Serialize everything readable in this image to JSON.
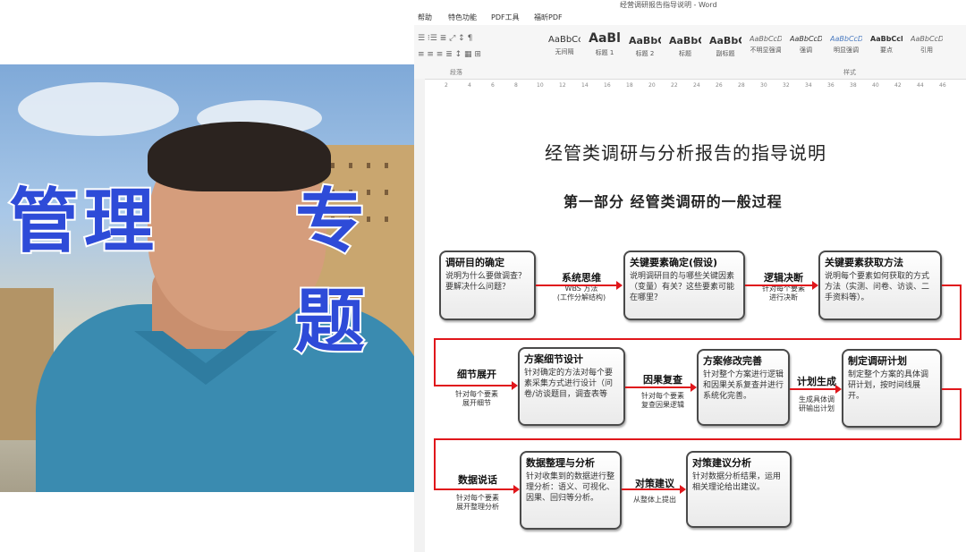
{
  "word": {
    "window_title": "经营调研报告指导说明 - Word",
    "menu": [
      "帮助",
      "特色功能",
      "PDF工具",
      "福昕PDF"
    ],
    "styles": [
      {
        "sample": "AaBbCcDd",
        "name": "无间隔"
      },
      {
        "sample": "AaBl",
        "name": "标题 1"
      },
      {
        "sample": "AaBbC",
        "name": "标题 2"
      },
      {
        "sample": "AaBbC",
        "name": "标题"
      },
      {
        "sample": "AaBbC",
        "name": "副标题"
      },
      {
        "sample": "AaBbCcD",
        "name": "不明显强调"
      },
      {
        "sample": "AaBbCcD",
        "name": "强调"
      },
      {
        "sample": "AaBbCcD",
        "name": "明显强调"
      },
      {
        "sample": "AaBbCcD",
        "name": "要点"
      },
      {
        "sample": "AaBbCcD",
        "name": "引用"
      }
    ],
    "group_paragraph": "段落",
    "group_styles": "样式",
    "ruler": [
      "2",
      "4",
      "6",
      "8",
      "10",
      "12",
      "14",
      "16",
      "18",
      "20",
      "22",
      "24",
      "26",
      "28",
      "30",
      "32",
      "34",
      "36",
      "38",
      "40",
      "42",
      "44",
      "46"
    ]
  },
  "webcam": {
    "banner_left": "管理",
    "banner_right": "专题"
  },
  "document": {
    "title": "经管类调研与分析报告的指导说明",
    "subtitle": "第一部分   经管类调研的一般过程"
  },
  "flow": {
    "boxes": [
      {
        "title": "调研目的确定",
        "desc": "说明为什么要做调查？要解决什么问题？"
      },
      {
        "title": "关键要素确定(假设)",
        "desc": "说明调研目的与哪些关键因素（变量）有关？这些要素可能在哪里？"
      },
      {
        "title": "关键要素获取方法",
        "desc": "说明每个要素如何获取的方式方法（实测、问卷、访谈、二手资料等）。"
      },
      {
        "title": "方案细节设计",
        "desc": "针对确定的方法对每个要素采集方式进行设计（问卷/访谈题目，调查表等"
      },
      {
        "title": "方案修改完善",
        "desc": "针对整个方案进行逻辑和因果关系复查并进行系统化完善。"
      },
      {
        "title": "制定调研计划",
        "desc": "制定整个方案的具体调研计划，按时间线展开。"
      },
      {
        "title": "数据整理与分析",
        "desc": "针对收集到的数据进行整理分析：语义、可视化、因果、回归等分析。"
      },
      {
        "title": "对策建议分析",
        "desc": "针对数据分析结果，运用相关理论给出建议。"
      }
    ],
    "connectors": [
      {
        "title": "系统思维",
        "desc1": "WBS 方法",
        "desc2": "(工作分解结构)"
      },
      {
        "title": "逻辑决断",
        "desc1": "针对每个要素",
        "desc2": "进行决断"
      },
      {
        "title": "细节展开",
        "desc1": "针对每个要素",
        "desc2": "展开细节"
      },
      {
        "title": "因果复查",
        "desc1": "针对每个要素",
        "desc2": "复查因果逻辑"
      },
      {
        "title": "计划生成",
        "desc1": "生成具体调",
        "desc2": "研输出计划"
      },
      {
        "title": "数据说话",
        "desc1": "针对每个要素",
        "desc2": "展开整理分析"
      },
      {
        "title": "对策建议",
        "desc1": "从整体上提出",
        "desc2": ""
      }
    ]
  }
}
